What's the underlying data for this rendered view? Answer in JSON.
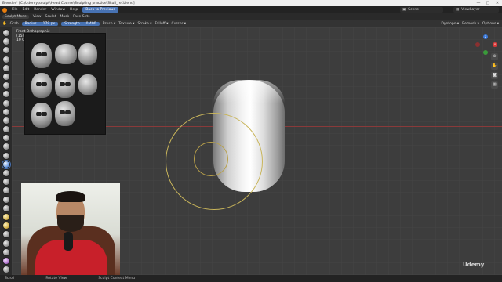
{
  "window": {
    "title": "Blender* [C:\\Udemy\\sculpt\\Head Course\\Sculpting practice\\Skull_ref.blend]",
    "controls": [
      "—",
      "□",
      "✕"
    ]
  },
  "menubar": {
    "items": [
      "File",
      "Edit",
      "Render",
      "Window",
      "Help"
    ],
    "back_button": "Back to Previous",
    "scene": "Scene",
    "view_layer": "ViewLayer"
  },
  "modebar": {
    "mode": "Sculpt Mode",
    "items": [
      "View",
      "Sculpt",
      "Mask",
      "Face Sets"
    ],
    "right_items": [
      "Dyntopo",
      "Remesh",
      "Options"
    ]
  },
  "toolbar": {
    "tool_name": "Grab",
    "radius_label": "Radius",
    "radius_value": "179 px",
    "strength_label": "Strength",
    "strength_value": "0.400",
    "menus": [
      "Brush",
      "Texture",
      "Stroke",
      "Falloff",
      "Cursor"
    ]
  },
  "viewport": {
    "view_name": "Front Orthographic",
    "frame": "(154)",
    "object": "10 Ce"
  },
  "statusbar": {
    "items": [
      "Scroll",
      "Rotate View",
      "Sculpt Context Menu"
    ]
  },
  "watermark": "Udemy",
  "colors": {
    "accent": "#4772b3",
    "brush_circle": "#c9b55a",
    "x_axis": "#8a3a3a"
  }
}
